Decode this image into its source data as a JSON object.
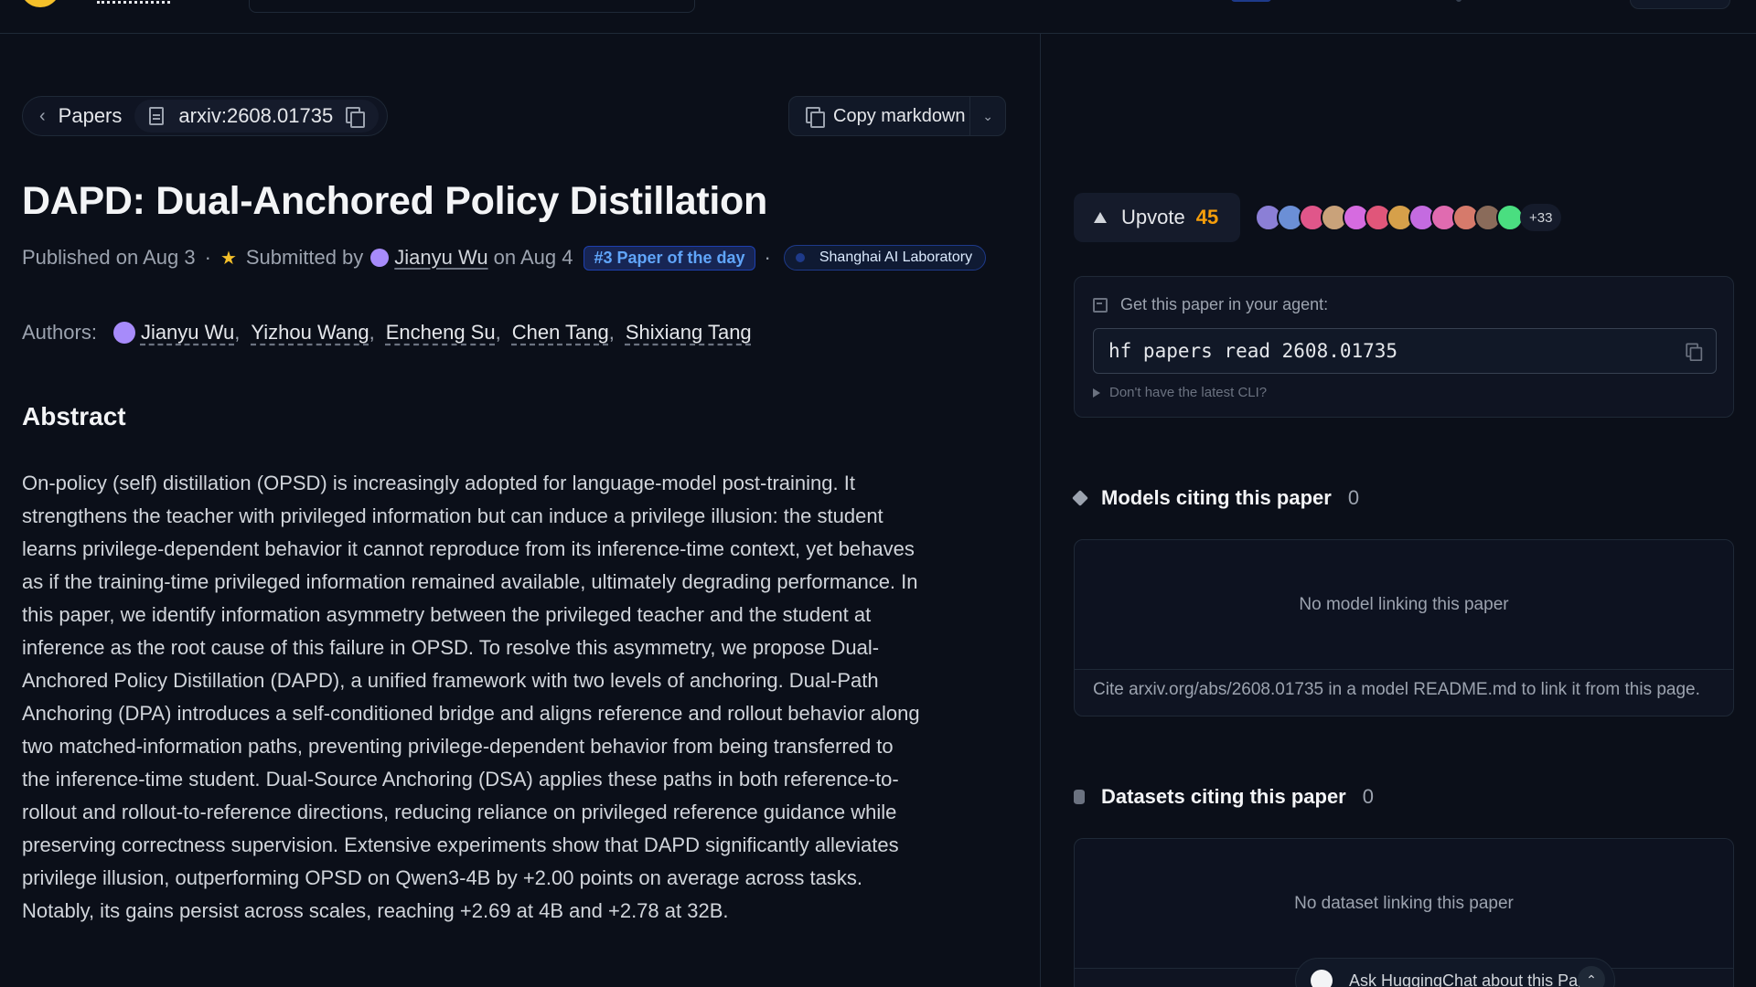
{
  "breadcrumb": {
    "back_label": "Papers",
    "paper_id": "arxiv:2608.01735"
  },
  "toolbar": {
    "copy_markdown_label": "Copy markdown"
  },
  "paper": {
    "title": "DAPD: Dual-Anchored Policy Distillation",
    "published": "Published on Aug 3",
    "submitted_by_prefix": "Submitted by",
    "submitter": "Jianyu Wu",
    "submitted_on": "on Aug 4",
    "paper_of_day": "#3 Paper of the day",
    "organization": "Shanghai AI Laboratory",
    "authors_label": "Authors:",
    "authors": [
      "Jianyu Wu",
      "Yizhou Wang",
      "Encheng Su",
      "Chen Tang",
      "Shixiang Tang"
    ],
    "abstract_heading": "Abstract",
    "abstract": "On-policy (self) distillation (OPSD) is increasingly adopted for language-model post-training. It strengthens the teacher with privileged information but can induce a privilege illusion: the student learns privilege-dependent behavior it cannot reproduce from its inference-time context, yet behaves as if the training-time privileged information remained available, ultimately degrading performance. In this paper, we identify information asymmetry between the privileged teacher and the student at inference as the root cause of this failure in OPSD. To resolve this asymmetry, we propose Dual-Anchored Policy Distillation (DAPD), a unified framework with two levels of anchoring. Dual-Path Anchoring (DPA) introduces a self-conditioned bridge and aligns reference and rollout behavior along two matched-information paths, preventing privilege-dependent behavior from being transferred to the inference-time student. Dual-Source Anchoring (DSA) applies these paths in both reference-to-rollout and rollout-to-reference directions, reducing reliance on privileged reference guidance while preserving correctness supervision. Extensive experiments show that DAPD significantly alleviates privilege illusion, outperforming OPSD on Qwen3-4B by +2.00 points on average across tasks. Notably, its gains persist across scales, reaching +2.69 at 4B and +2.78 at 32B."
  },
  "upvote": {
    "label": "Upvote",
    "count": "45",
    "more_voters": "+33",
    "voter_colors": [
      "#8b7fd6",
      "#6b8fd6",
      "#e0568a",
      "#c9a27a",
      "#d66be0",
      "#e0567a",
      "#d6a04a",
      "#c46be0",
      "#e06bb0",
      "#d67a6b",
      "#8a6b5a",
      "#4ade80"
    ]
  },
  "agent": {
    "heading": "Get this paper in your agent:",
    "command": "hf papers read 2608.01735",
    "cli_hint": "Don't have the latest CLI?"
  },
  "models": {
    "heading": "Models citing this paper",
    "count": "0",
    "empty": "No model linking this paper",
    "hint": "Cite arxiv.org/abs/2608.01735 in a model README.md to link it from this page."
  },
  "datasets": {
    "heading": "Datasets citing this paper",
    "count": "0",
    "empty": "No dataset linking this paper"
  },
  "chat": {
    "placeholder": "Ask HuggingChat about this Paper"
  }
}
